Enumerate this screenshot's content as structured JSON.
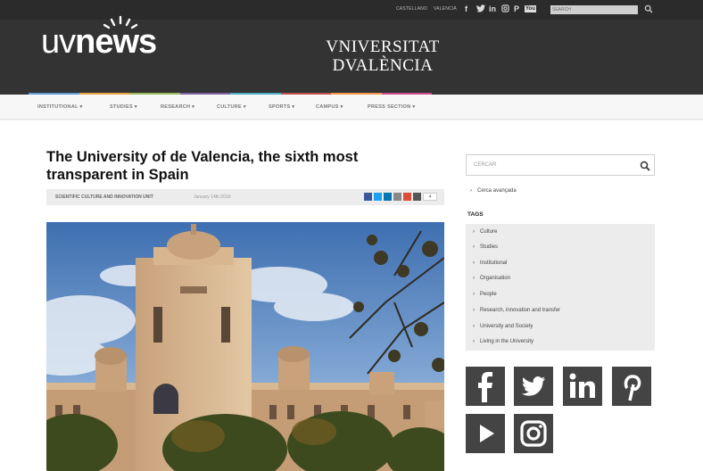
{
  "topbar": {
    "lang_1": "CASTELLANO",
    "lang_2": "VALENCIÀ",
    "search_placeholder": "SEARCH",
    "social": [
      "facebook",
      "twitter",
      "linkedin",
      "instagram",
      "pinterest",
      "youtube"
    ],
    "youtube_label": "You"
  },
  "header": {
    "logo_uv": "uv",
    "logo_news": "news",
    "university_line1": "VNIVERSITAT",
    "university_line2": "DVALÈNCIA",
    "strip_colors": [
      "#5b9bd5",
      "#e8a33d",
      "#9bbb59",
      "#8064a2",
      "#4bacc6",
      "#c0504d",
      "#f79646",
      "#d0498f"
    ]
  },
  "nav": {
    "items": [
      "INSTITUTIONAL ▾",
      "STUDIES ▾",
      "RESEARCH ▾",
      "CULTURE ▾",
      "SPORTS ▾",
      "CAMPUS ▾",
      "PRESS SECTION ▾"
    ]
  },
  "article": {
    "title": "The University of de Valencia, the sixth most transparent in Spain",
    "unit": "SCIENTIFIC CULTURE AND INNOVATION UNIT",
    "date": "January 14th 2019",
    "share_count": "4",
    "share_colors": [
      "#3b5998",
      "#1da1f2",
      "#0077b5",
      "#888888",
      "#dd4b39",
      "#555555"
    ]
  },
  "sidebar": {
    "search_placeholder": "CERCAR",
    "advanced": "Cerca avançada",
    "tags_heading": "TAGS",
    "tags": [
      "Culture",
      "Studies",
      "Institutional",
      "Organisation",
      "People",
      "Research, innovation and transfer",
      "University and Society",
      "Living in the University"
    ],
    "social_tiles": [
      "facebook-icon",
      "twitter-icon",
      "linkedin-icon",
      "pinterest-icon",
      "youtube-icon",
      "instagram-icon"
    ]
  }
}
